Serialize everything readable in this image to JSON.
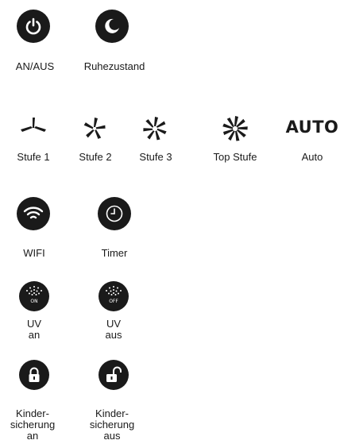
{
  "colors": {
    "icon": "#1a1a1a",
    "icon_fg": "#ffffff",
    "text": "#1a1a1a"
  },
  "power": {
    "label": "AN/AUS",
    "icon": "power-icon"
  },
  "sleep": {
    "label": "Ruhezustand",
    "icon": "moon-icon"
  },
  "speeds": [
    {
      "label": "Stufe 1",
      "icon": "fan-speed-1-icon"
    },
    {
      "label": "Stufe 2",
      "icon": "fan-speed-2-icon"
    },
    {
      "label": "Stufe 3",
      "icon": "fan-speed-3-icon"
    },
    {
      "label": "Top Stufe",
      "icon": "fan-speed-top-icon"
    },
    {
      "label": "Auto",
      "icon": "auto-text-icon",
      "icon_text": "AUTO"
    }
  ],
  "wifi": {
    "label": "WIFI",
    "icon": "wifi-icon"
  },
  "timer": {
    "label": "Timer",
    "icon": "clock-icon"
  },
  "uv_on": {
    "label": "UV\nan",
    "badge": "ON",
    "icon": "uv-on-icon"
  },
  "uv_off": {
    "label": "UV\naus",
    "badge": "OFF",
    "icon": "uv-off-icon"
  },
  "lock_on": {
    "label": "Kinder-\nsicherung\nan",
    "icon": "lock-closed-icon"
  },
  "lock_off": {
    "label": "Kinder-\nsicherung\naus",
    "icon": "lock-open-icon"
  }
}
